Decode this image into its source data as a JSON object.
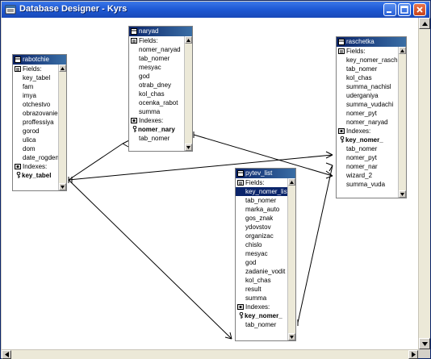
{
  "window": {
    "title": "Database Designer - Kyrs"
  },
  "tables": {
    "rabotchie": {
      "title": "rabotchie",
      "fields_label": "Fields:",
      "fields": [
        "key_tabel",
        "fam",
        "imya",
        "otchestvo",
        "obrazovanie",
        "proffessiya",
        "gorod",
        "ulica",
        "dom",
        "date_rogden"
      ],
      "indexes_label": "Indexes:",
      "indexes": [
        "key_tabel"
      ]
    },
    "naryad": {
      "title": "naryad",
      "fields_label": "Fields:",
      "fields": [
        "nomer_naryad",
        "tab_nomer",
        "mesyac",
        "god",
        "otrab_dney",
        "kol_chas",
        "ocenka_rabot",
        "summa"
      ],
      "indexes_label": "Indexes:",
      "indexes": [
        "nomer_nary",
        "tab_nomer"
      ]
    },
    "raschetka": {
      "title": "raschetka",
      "fields_label": "Fields:",
      "fields": [
        "key_nomer_raschet",
        "tab_nomer",
        "kol_chas",
        "summa_nachisl",
        "uderganiya",
        "summa_vudachi",
        "nomer_pyt",
        "nomer_naryad"
      ],
      "indexes_label": "Indexes:",
      "indexes": [
        "key_nomer_",
        "tab_nomer",
        "nomer_pyt",
        "nomer_nar",
        "wizard_2",
        "summa_vuda"
      ]
    },
    "pytev_list": {
      "title": "pytev_list",
      "fields_label": "Fields:",
      "fields": [
        "key_nomer_lista",
        "tab_nomer",
        "marka_auto",
        "gos_znak",
        "ydovstov",
        "organizac",
        "chislo",
        "mesyac",
        "god",
        "zadanie_vodit",
        "kol_chas",
        "result",
        "summa"
      ],
      "indexes_label": "Indexes:",
      "indexes": [
        "key_nomer_",
        "tab_nomer"
      ]
    }
  },
  "colors": {
    "title_bar": "#1f5ad6",
    "table_header": "#0a246a",
    "selection": "#0a246a"
  },
  "icons": {
    "app": "database-icon",
    "table": "table-icon",
    "fields": "fields-icon",
    "indexes": "indexes-icon",
    "key": "key-icon"
  }
}
